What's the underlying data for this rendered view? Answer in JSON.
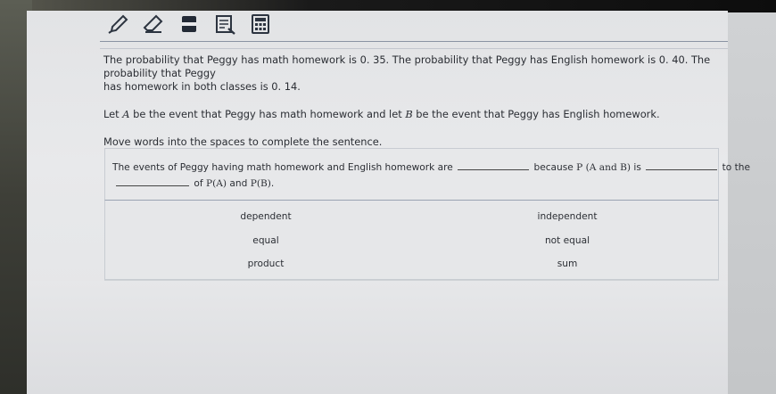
{
  "toolbar": {
    "tools": [
      {
        "name": "pencil-tool",
        "icon": "pencil-icon"
      },
      {
        "name": "eraser-tool",
        "icon": "eraser-icon"
      },
      {
        "name": "highlighter-tool",
        "icon": "highlighter-icon"
      },
      {
        "name": "notes-tool",
        "icon": "notepad-icon"
      },
      {
        "name": "calculator-tool",
        "icon": "calculator-icon"
      }
    ]
  },
  "question": {
    "paragraph1_line1": "The probability that Peggy has math homework is 0. 35. The probability that Peggy has English homework is 0. 40. The probability that Peggy",
    "paragraph1_line2": "has homework in both classes is 0. 14.",
    "paragraph2_a": "Let ",
    "event_a": "A",
    "paragraph2_b": " be the event that Peggy has math homework and let ",
    "event_b": "B",
    "paragraph2_c": " be the event that Peggy has English homework.",
    "instruction": "Move words into the spaces to complete the sentence."
  },
  "sentence": {
    "part1": "The events of Peggy having math homework and English homework are",
    "part2": "because ",
    "expr": "P (A  and  B)",
    "part3": " is",
    "part4": "to the",
    "part5": "of ",
    "pa": "P(A)",
    "and": " and ",
    "pb": "P(B)",
    "period": "."
  },
  "word_bank": [
    {
      "label": "dependent"
    },
    {
      "label": "independent"
    },
    {
      "label": "equal"
    },
    {
      "label": "not equal"
    },
    {
      "label": "product"
    },
    {
      "label": "sum"
    }
  ]
}
